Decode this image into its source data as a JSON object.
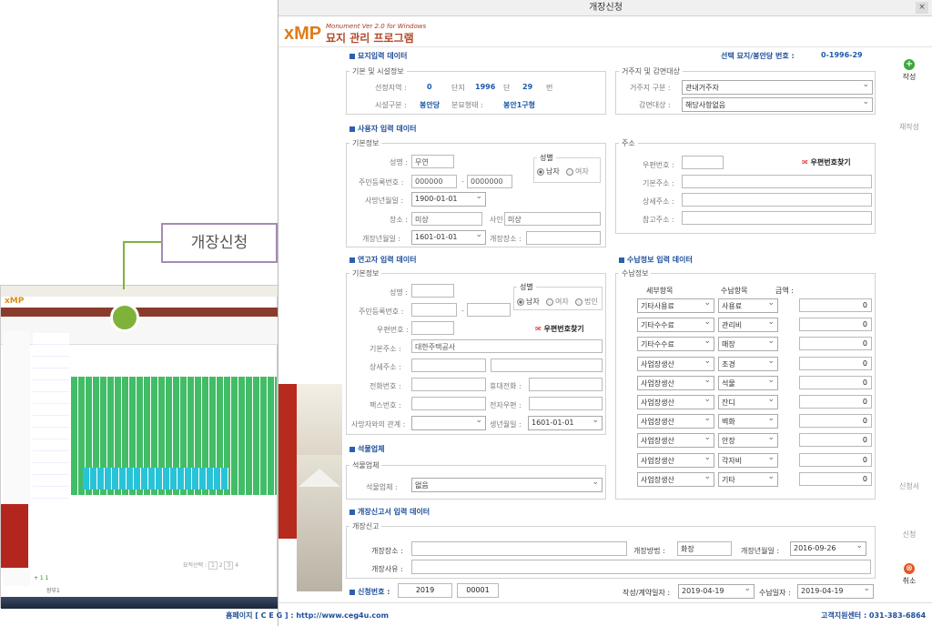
{
  "bg": {
    "count_icon_count": "+ 1 1",
    "nav_pages": [
      "1",
      "2",
      "3",
      "4"
    ],
    "page_label": "묘적선택 :",
    "status_left": "장부1"
  },
  "callout": {
    "label": "개장신청"
  },
  "window": {
    "title": "개장신청",
    "close": "×"
  },
  "banner": {
    "logo": "xMP",
    "subtitle": "Monument Ver 2.0 for Windows",
    "program_name": "묘지 관리 프로그램"
  },
  "grave_data": {
    "section": "묘지입력 데이터",
    "selected_label": "선택 묘지/봉안당 번호 :",
    "selected_value": "0-1996-29",
    "basic": {
      "title": "기본 및 시설정보",
      "region_label": "선정지역 :",
      "region_value": "0",
      "block_label": "단지",
      "block_value": "1996",
      "row_label": "단",
      "row_value": "29",
      "num_label": "번",
      "facility_label": "시설구분 :",
      "facility_value": "봉안당",
      "shape_label": "분묘형태 :",
      "shape_value": "봉안1구형"
    },
    "residence": {
      "title": "거주지 및 감면대상",
      "residence_label": "거주지 구분 :",
      "residence_value": "관내거주자",
      "reduction_label": "감면대상 :",
      "reduction_value": "해당사항없음"
    }
  },
  "user_data": {
    "section": "사용자 입력 데이터",
    "basic_title": "기본정보",
    "name_label": "성명 :",
    "name_value": "무연",
    "gender_title": "성별",
    "male": "남자",
    "female": "여자",
    "rrn_label": "주민등록번호 :",
    "rrn1": "000000",
    "rrn_dash": "-",
    "rrn2": "0000000",
    "death_label": "사망년월일 :",
    "death_value": "1900-01-01",
    "burial_label": "장소 :",
    "burial_value": "미상",
    "cause_label": "사인 :",
    "cause_value": "미상",
    "open_date_label": "개장년월일 :",
    "open_date_value": "1601-01-01",
    "open_place_label": "개장장소 :",
    "open_place_value": "",
    "address_title": "주소",
    "zip_label": "우편번호 :",
    "zip_value": "",
    "zip_button": "우편번호찾기",
    "addr_label": "기본주소 :",
    "addr_value": "",
    "detail_label": "상세주소 :",
    "detail_value": "",
    "ref_label": "참고주소 :",
    "ref_value": ""
  },
  "relation_data": {
    "section": "연고자 입력 데이터",
    "basic_title": "기본정보",
    "name_label": "성명 :",
    "name_value": "",
    "gender_title": "성별",
    "male": "남자",
    "female": "여자",
    "corp": "법인",
    "rrn_label": "주민등록번호 :",
    "rrn_dash": "-",
    "zip_label": "우편번호 :",
    "zip_button": "우편번호찾기",
    "addr_label": "기본주소 :",
    "addr_value": "대한주택공사",
    "detail_label": "상세주소 :",
    "phone_label": "전화번호 :",
    "phone_value": "",
    "mobile_label": "휴대전화 :",
    "fax_label": "팩스번호 :",
    "email_label": "전자우편 :",
    "relation_label": "사망자와의 관계 :",
    "birth_label": "생년월일 :",
    "birth_value": "1601-01-01"
  },
  "stone_data": {
    "section": "석물업체",
    "group_title": "석물업체",
    "company_label": "석물업체 :",
    "company_value": "없음"
  },
  "payment_data": {
    "section": "수납정보 입력 데이터",
    "group_title": "수납정보",
    "col_detail": "세부항목",
    "col_item": "수납항목",
    "col_amount": "금액 :",
    "rows": [
      {
        "detail": "기타사용료",
        "item": "사용료",
        "amount": "0"
      },
      {
        "detail": "기타수수료",
        "item": "관리비",
        "amount": "0"
      },
      {
        "detail": "기타수수료",
        "item": "매장",
        "amount": "0"
      },
      {
        "detail": "사업장생산",
        "item": "조경",
        "amount": "0"
      },
      {
        "detail": "사업장생산",
        "item": "석물",
        "amount": "0"
      },
      {
        "detail": "사업장생산",
        "item": "잔디",
        "amount": "0"
      },
      {
        "detail": "사업장생산",
        "item": "벽화",
        "amount": "0"
      },
      {
        "detail": "사업장생산",
        "item": "안장",
        "amount": "0"
      },
      {
        "detail": "사업장생산",
        "item": "각자비",
        "amount": "0"
      },
      {
        "detail": "사업장생산",
        "item": "기타",
        "amount": "0"
      }
    ]
  },
  "report_data": {
    "section": "개장신고서 입력 데이터",
    "group_title": "개장신고",
    "place_label": "개장장소 :",
    "place_value": "",
    "method_label": "개장방법 :",
    "method_value": "화장",
    "date_label": "개장년월일 :",
    "date_value": "2016-09-26",
    "reason_label": "개장사유 :",
    "reason_value": ""
  },
  "footer": {
    "app_no_label": "신청번호 :",
    "app_no_year": "2019",
    "app_no_dash": "-",
    "app_no_seq": "00001",
    "contract_label": "작성/계약일자 :",
    "contract_value": "2019-04-19",
    "receipt_label": "수납일자 :",
    "receipt_value": "2019-04-19"
  },
  "sidebar": {
    "write": "작성",
    "rewrite": "재작성",
    "apply_doc": "신청서",
    "apply": "신청",
    "cancel": "취소"
  },
  "status": {
    "homepage": "홈페이지 [ C E G ] : http://www.ceg4u.com",
    "support": "고객지원센터 : 031-383-6864"
  }
}
